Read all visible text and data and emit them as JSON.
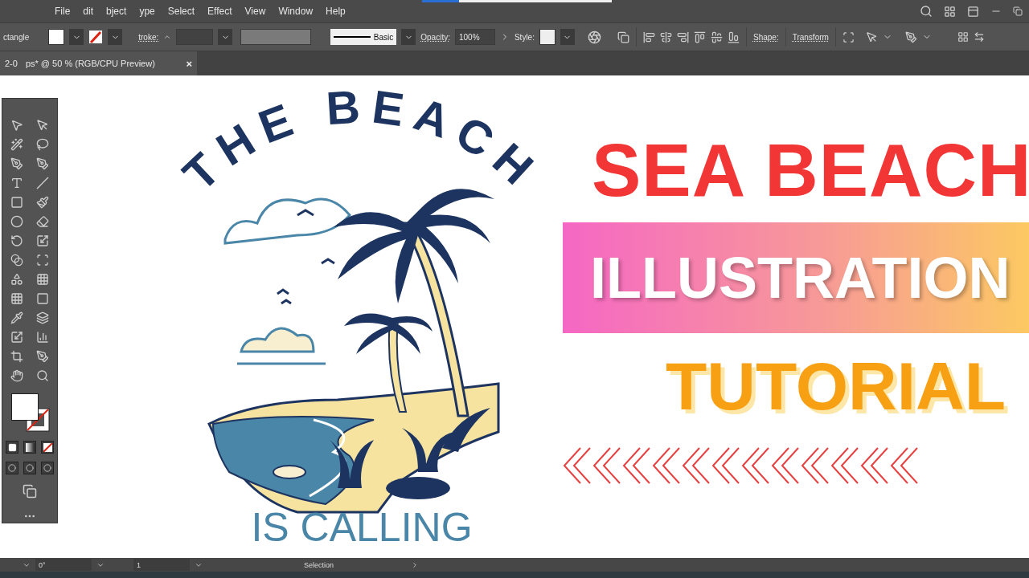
{
  "menu": [
    {
      "label": "File"
    },
    {
      "label": "dit"
    },
    {
      "label": "bject"
    },
    {
      "label": "ype"
    },
    {
      "label": "Select"
    },
    {
      "label": "Effect"
    },
    {
      "label": "View"
    },
    {
      "label": "Window"
    },
    {
      "label": "Help"
    }
  ],
  "control_bar": {
    "tool_label": "ctangle",
    "stroke_label": "troke:",
    "brush": "Basic",
    "opacity_label": "Opacity:",
    "opacity": "100%",
    "style_label": "Style:",
    "shape_label": "Shape:",
    "transform_label": "Transform"
  },
  "document_tab": {
    "title": "2-0",
    "title_rest": "ps* @ 50 % (RGB/CPU Preview)",
    "close": "×"
  },
  "artwork": {
    "arc_text": "THE BEACH",
    "bottom_text": "IS CALLING"
  },
  "headline": {
    "line_1": "SEA BEACH",
    "line_2": "ILLUSTRATION",
    "line_3": "TUTORIAL"
  },
  "status_bar": {
    "rotation": "0°",
    "artboard": "1",
    "tool": "Selection"
  }
}
